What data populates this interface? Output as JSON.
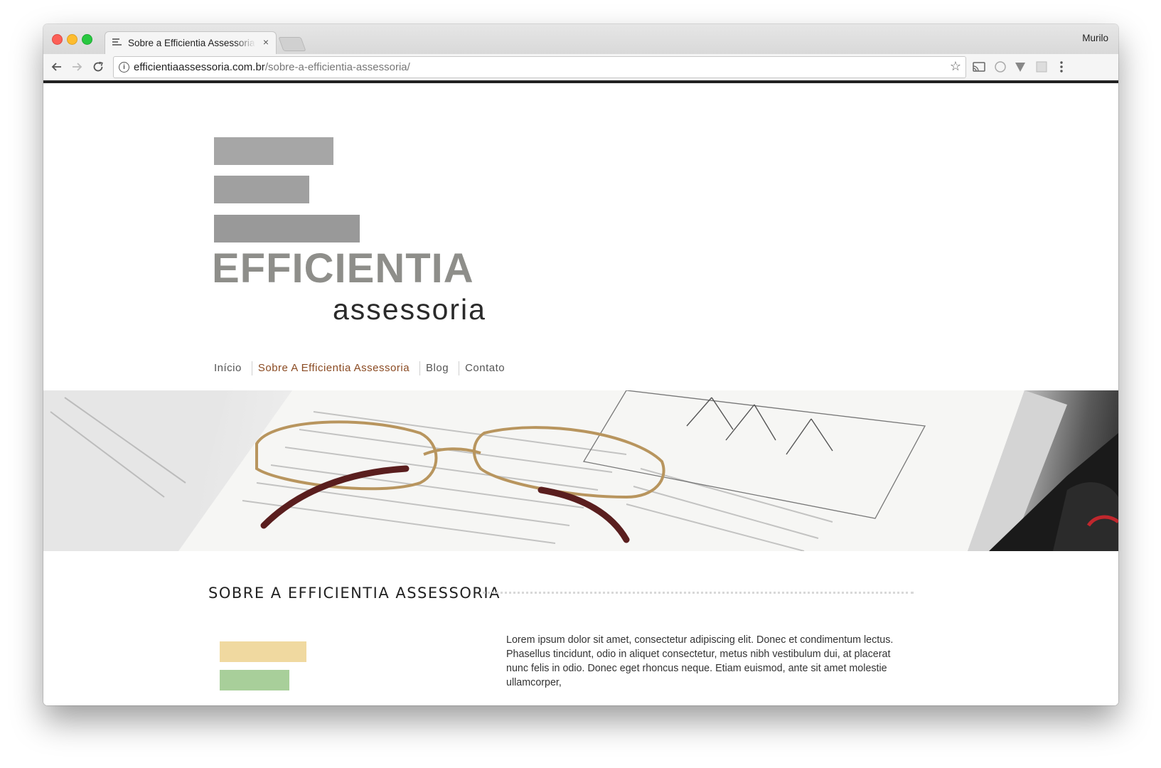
{
  "browser": {
    "tab_title": "Sobre a Efficientia Assessoria",
    "tab_close": "×",
    "profile_name": "Murilo",
    "url_host": "efficientiaassessoria.com.br",
    "url_path": "/sobre-a-efficientia-assessoria/",
    "icons": {
      "back": "arrow-left-icon",
      "forward": "arrow-right-icon",
      "reload": "reload-icon",
      "info": "info-icon",
      "bookmark": "star-icon",
      "cast": "cast-icon",
      "menu": "kebab-menu-icon"
    }
  },
  "site": {
    "logo_word": "EFFICIENTIA",
    "logo_sub": "assessoria",
    "nav": [
      {
        "label": "Início",
        "active": false
      },
      {
        "label": "Sobre A Efficientia Assessoria",
        "active": true
      },
      {
        "label": "Blog",
        "active": false
      },
      {
        "label": "Contato",
        "active": false
      }
    ],
    "accent_color": "#8a4a22",
    "section_title": "SOBRE A EFFICIENTIA ASSESSORIA",
    "body_text": "Lorem ipsum dolor sit amet, consectetur adipiscing elit. Donec et condimentum lectus. Phasellus tincidunt, odio in aliquet consectetur, metus nibh vestibulum dui, at placerat nunc felis in odio. Donec eget rhoncus neque. Etiam euismod, ante sit amet molestie ullamcorper,"
  }
}
